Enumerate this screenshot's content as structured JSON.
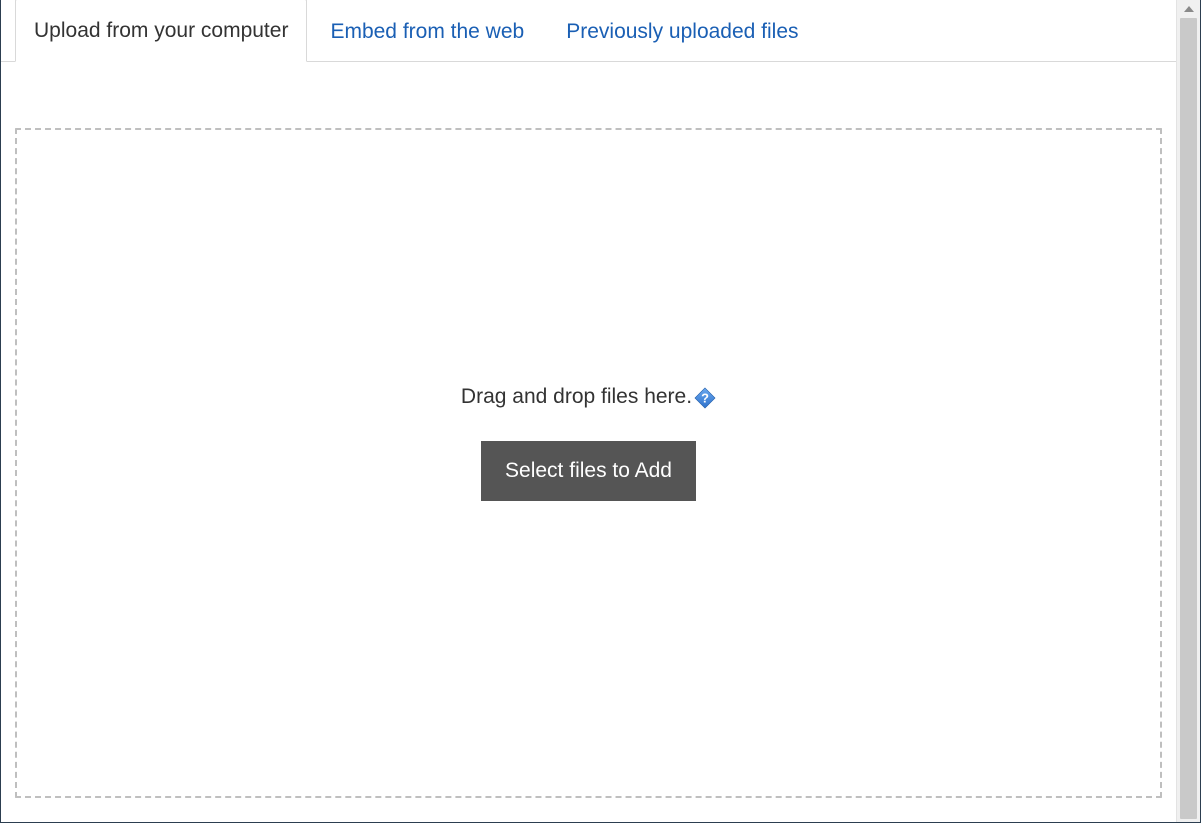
{
  "tabs": [
    {
      "label": "Upload from your computer",
      "active": true
    },
    {
      "label": "Embed from the web",
      "active": false
    },
    {
      "label": "Previously uploaded files",
      "active": false
    }
  ],
  "dropzone": {
    "instruction": "Drag and drop files here.",
    "button_label": "Select files to Add"
  }
}
